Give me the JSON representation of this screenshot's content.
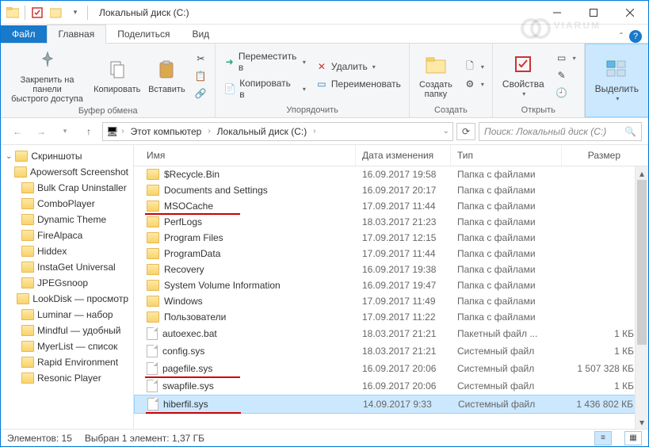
{
  "window": {
    "title": "Локальный диск (C:)"
  },
  "tabs": {
    "file": "Файл",
    "home": "Главная",
    "share": "Поделиться",
    "view": "Вид"
  },
  "ribbon": {
    "clipboard": {
      "pin": "Закрепить на панели\nбыстрого доступа",
      "copy": "Копировать",
      "paste": "Вставить",
      "label": "Буфер обмена"
    },
    "organize": {
      "move": "Переместить в",
      "copyto": "Копировать в",
      "delete": "Удалить",
      "rename": "Переименовать",
      "label": "Упорядочить"
    },
    "create": {
      "newfolder": "Создать\nпапку",
      "label": "Создать"
    },
    "open": {
      "properties": "Свойства",
      "label": "Открыть"
    },
    "select": {
      "select": "Выделить",
      "label": ""
    }
  },
  "address": {
    "crumbs": [
      "Этот компьютер",
      "Локальный диск (C:)"
    ],
    "search_placeholder": "Поиск: Локальный диск (C:)"
  },
  "tree": {
    "root": "Скриншоты",
    "items": [
      "Apowersoft Screenshot",
      "Bulk Crap Uninstaller",
      "ComboPlayer",
      "Dynamic Theme",
      "FireAlpaca",
      "Hiddex",
      "InstaGet Universal",
      "JPEGsnoop",
      "LookDisk — просмотр",
      "Luminar — набор",
      "Mindful — удобный",
      "MyerList — список",
      "Rapid Environment",
      "Resonic Player"
    ]
  },
  "columns": {
    "name": "Имя",
    "date": "Дата изменения",
    "type": "Тип",
    "size": "Размер"
  },
  "rows": [
    {
      "icon": "folder",
      "name": "$Recycle.Bin",
      "date": "16.09.2017 19:58",
      "type": "Папка с файлами",
      "size": ""
    },
    {
      "icon": "folder",
      "name": "Documents and Settings",
      "date": "16.09.2017 20:17",
      "type": "Папка с файлами",
      "size": ""
    },
    {
      "icon": "folder",
      "name": "MSOCache",
      "date": "17.09.2017 11:44",
      "type": "Папка с файлами",
      "size": "",
      "underline": true
    },
    {
      "icon": "folder",
      "name": "PerfLogs",
      "date": "18.03.2017 21:23",
      "type": "Папка с файлами",
      "size": ""
    },
    {
      "icon": "folder",
      "name": "Program Files",
      "date": "17.09.2017 12:15",
      "type": "Папка с файлами",
      "size": ""
    },
    {
      "icon": "folder",
      "name": "ProgramData",
      "date": "17.09.2017 11:44",
      "type": "Папка с файлами",
      "size": ""
    },
    {
      "icon": "folder",
      "name": "Recovery",
      "date": "16.09.2017 19:38",
      "type": "Папка с файлами",
      "size": ""
    },
    {
      "icon": "folder",
      "name": "System Volume Information",
      "date": "16.09.2017 19:47",
      "type": "Папка с файлами",
      "size": ""
    },
    {
      "icon": "folder",
      "name": "Windows",
      "date": "17.09.2017 11:49",
      "type": "Папка с файлами",
      "size": ""
    },
    {
      "icon": "folder",
      "name": "Пользователи",
      "date": "17.09.2017 11:22",
      "type": "Папка с файлами",
      "size": ""
    },
    {
      "icon": "file",
      "name": "autoexec.bat",
      "date": "18.03.2017 21:21",
      "type": "Пакетный файл ...",
      "size": "1 КБ"
    },
    {
      "icon": "file",
      "name": "config.sys",
      "date": "18.03.2017 21:21",
      "type": "Системный файл",
      "size": "1 КБ"
    },
    {
      "icon": "file",
      "name": "pagefile.sys",
      "date": "16.09.2017 20:06",
      "type": "Системный файл",
      "size": "1 507 328 КБ",
      "underline": true
    },
    {
      "icon": "file",
      "name": "swapfile.sys",
      "date": "16.09.2017 20:06",
      "type": "Системный файл",
      "size": "1 КБ"
    },
    {
      "icon": "file",
      "name": "hiberfil.sys",
      "date": "14.09.2017 9:33",
      "type": "Системный файл",
      "size": "1 436 802 КБ",
      "selected": true,
      "underline": true
    }
  ],
  "status": {
    "count": "Элементов: 15",
    "selection": "Выбран 1 элемент: 1,37 ГБ"
  },
  "watermark": "VIARUM"
}
